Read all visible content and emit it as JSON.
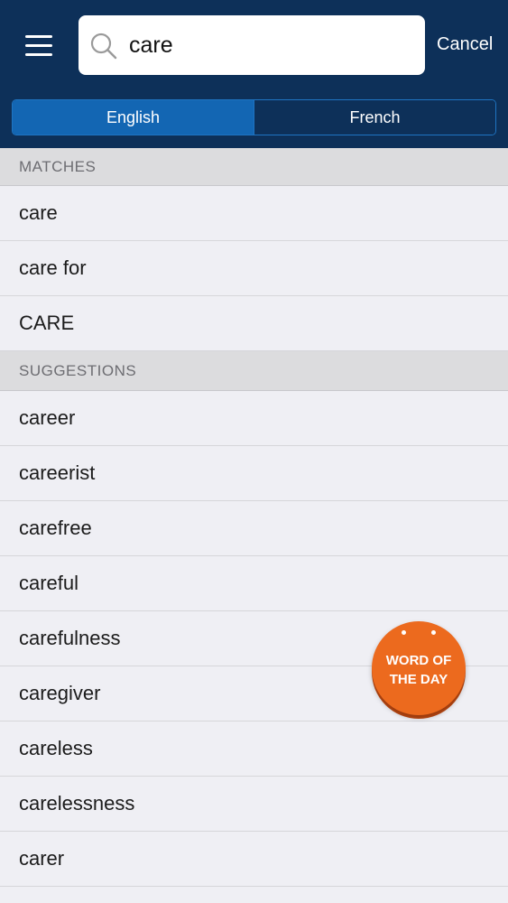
{
  "header": {
    "menu_icon": "hamburger-menu-icon",
    "search": {
      "icon": "search-icon",
      "value": "care",
      "placeholder": ""
    },
    "cancel_label": "Cancel"
  },
  "language_tabs": {
    "items": [
      {
        "label": "English",
        "selected": true
      },
      {
        "label": "French",
        "selected": false
      }
    ]
  },
  "matches": {
    "header": "MATCHES",
    "items": [
      "care",
      "care for",
      "CARE"
    ]
  },
  "suggestions": {
    "header": "SUGGESTIONS",
    "items": [
      "career",
      "careerist",
      "carefree",
      "careful",
      "carefulness",
      "caregiver",
      "careless",
      "carelessness",
      "carer"
    ]
  },
  "word_of_the_day": {
    "line1": "WORD OF",
    "line2": "THE DAY",
    "color": "#ec6a1e"
  },
  "colors": {
    "topbar": "#0d3059",
    "tab_active": "#1366b3",
    "background": "#efeff4"
  }
}
